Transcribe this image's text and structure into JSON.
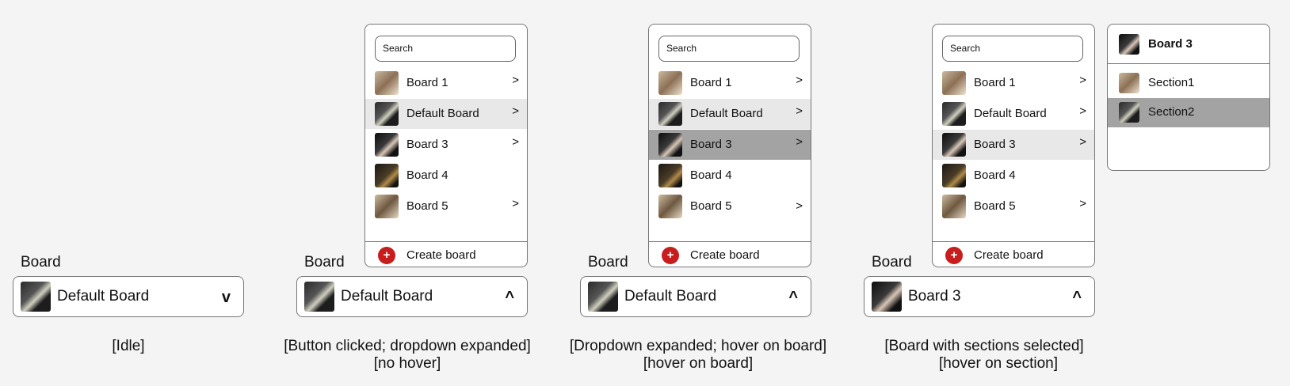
{
  "field_label": "Board",
  "search_placeholder": "Search",
  "create_label": "Create board",
  "create_icon": "+",
  "chevron": ">",
  "boards": [
    "Board 1",
    "Default Board",
    "Board 3",
    "Board 4",
    "Board 5"
  ],
  "caret_closed": "v",
  "caret_open": "^",
  "selected": {
    "idle": "Default Board",
    "expanded": "Default Board",
    "hover": "Default Board",
    "sections": "Board 3"
  },
  "captions": {
    "idle": "[Idle]",
    "expanded_1": "[Button clicked; dropdown expanded]",
    "expanded_2": "[no hover]",
    "hover_1": "[Dropdown expanded; hover on board]",
    "hover_2": "[hover on board]",
    "sections_1": "[Board with sections selected]",
    "sections_2": "[hover on section]"
  },
  "sections_panel": {
    "title": "Board 3",
    "items": [
      "Section1",
      "Section2"
    ]
  },
  "colors": {
    "accent": "#c81d1d",
    "hover_light": "#e8e8e8",
    "hover_dark": "#a3a3a3"
  }
}
